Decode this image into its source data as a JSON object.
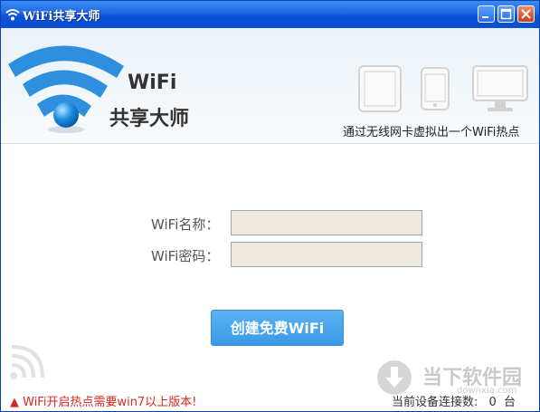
{
  "window": {
    "title": "WiFi共享大师"
  },
  "header": {
    "brand_line1": "WiFi",
    "brand_line2": "共享大师",
    "tagline": "通过无线网卡虚拟出一个WiFi热点"
  },
  "form": {
    "name_label": "WiFi名称：",
    "name_value": "",
    "password_label": "WiFi密码：",
    "password_value": ""
  },
  "actions": {
    "create_label": "创建免费WiFi"
  },
  "footer": {
    "warning": "▲ WiFi开启热点需要win7以上版本!",
    "status_label": "当前设备连接数:",
    "status_count": "0",
    "status_unit": "台"
  },
  "watermark": {
    "site_name": "当下软件园",
    "site_url": "downxia.com"
  }
}
